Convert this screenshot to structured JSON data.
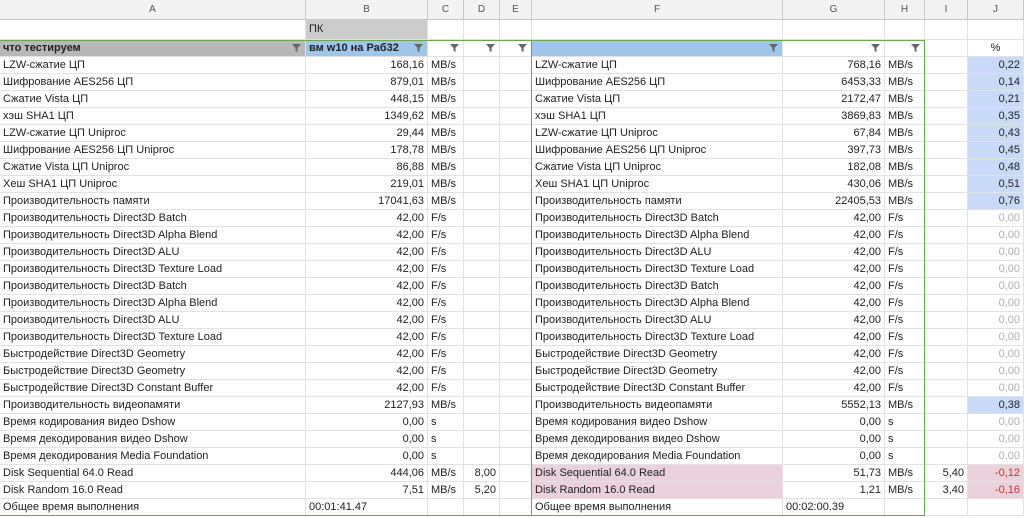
{
  "columns": [
    "A",
    "B",
    "C",
    "D",
    "E",
    "F",
    "G",
    "H",
    "I",
    "J"
  ],
  "pk_label": "ПК",
  "header": {
    "a": "что тестируем",
    "b": "вм w10 на Раб32",
    "j": "%"
  },
  "rows": [
    {
      "a": "LZW-сжатие ЦП",
      "b": "168,16",
      "c": "MB/s",
      "d": "",
      "f": "LZW-сжатие ЦП",
      "g": "768,16",
      "h": "MB/s",
      "i": "",
      "j": "0,22",
      "jc": "blue"
    },
    {
      "a": "Шифрование AES256 ЦП",
      "b": "879,01",
      "c": "MB/s",
      "d": "",
      "f": "Шифрование AES256 ЦП",
      "g": "6453,33",
      "h": "MB/s",
      "i": "",
      "j": "0,14",
      "jc": "blue"
    },
    {
      "a": "Сжатие Vista ЦП",
      "b": "448,15",
      "c": "MB/s",
      "d": "",
      "f": "Сжатие Vista ЦП",
      "g": "2172,47",
      "h": "MB/s",
      "i": "",
      "j": "0,21",
      "jc": "blue"
    },
    {
      "a": "хэш SHA1 ЦП",
      "b": "1349,62",
      "c": "MB/s",
      "d": "",
      "f": "хэш SHA1 ЦП",
      "g": "3869,83",
      "h": "MB/s",
      "i": "",
      "j": "0,35",
      "jc": "blue"
    },
    {
      "a": "LZW-сжатие ЦП Uniproc",
      "b": "29,44",
      "c": "MB/s",
      "d": "",
      "f": "LZW-сжатие ЦП Uniproc",
      "g": "67,84",
      "h": "MB/s",
      "i": "",
      "j": "0,43",
      "jc": "blue"
    },
    {
      "a": "Шифрование AES256 ЦП Uniproc",
      "b": "178,78",
      "c": "MB/s",
      "d": "",
      "f": "Шифрование AES256 ЦП Uniproc",
      "g": "397,73",
      "h": "MB/s",
      "i": "",
      "j": "0,45",
      "jc": "blue"
    },
    {
      "a": "Сжатие Vista ЦП Uniproc",
      "b": "86,88",
      "c": "MB/s",
      "d": "",
      "f": "Сжатие Vista ЦП Uniproc",
      "g": "182,08",
      "h": "MB/s",
      "i": "",
      "j": "0,48",
      "jc": "blue"
    },
    {
      "a": "Хеш SHA1 ЦП Uniproc",
      "b": "219,01",
      "c": "MB/s",
      "d": "",
      "f": "Хеш SHA1 ЦП Uniproc",
      "g": "430,06",
      "h": "MB/s",
      "i": "",
      "j": "0,51",
      "jc": "blue"
    },
    {
      "a": "Производительность памяти",
      "b": "17041,63",
      "c": "MB/s",
      "d": "",
      "f": "Производительность памяти",
      "g": "22405,53",
      "h": "MB/s",
      "i": "",
      "j": "0,76",
      "jc": "blue"
    },
    {
      "a": "Производительность Direct3D Batch",
      "b": "42,00",
      "c": "F/s",
      "d": "",
      "f": "Производительность Direct3D Batch",
      "g": "42,00",
      "h": "F/s",
      "i": "",
      "j": "0,00",
      "jc": "grey"
    },
    {
      "a": "Производительность Direct3D Alpha Blend",
      "b": "42,00",
      "c": "F/s",
      "d": "",
      "f": "Производительность Direct3D Alpha Blend",
      "g": "42,00",
      "h": "F/s",
      "i": "",
      "j": "0,00",
      "jc": "grey"
    },
    {
      "a": "Производительность Direct3D ALU",
      "b": "42,00",
      "c": "F/s",
      "d": "",
      "f": "Производительность Direct3D ALU",
      "g": "42,00",
      "h": "F/s",
      "i": "",
      "j": "0,00",
      "jc": "grey"
    },
    {
      "a": "Производительность Direct3D Texture Load",
      "b": "42,00",
      "c": "F/s",
      "d": "",
      "f": "Производительность Direct3D Texture Load",
      "g": "42,00",
      "h": "F/s",
      "i": "",
      "j": "0,00",
      "jc": "grey"
    },
    {
      "a": "Производительность Direct3D Batch",
      "b": "42,00",
      "c": "F/s",
      "d": "",
      "f": "Производительность Direct3D Batch",
      "g": "42,00",
      "h": "F/s",
      "i": "",
      "j": "0,00",
      "jc": "grey"
    },
    {
      "a": "Производительность Direct3D Alpha Blend",
      "b": "42,00",
      "c": "F/s",
      "d": "",
      "f": "Производительность Direct3D Alpha Blend",
      "g": "42,00",
      "h": "F/s",
      "i": "",
      "j": "0,00",
      "jc": "grey"
    },
    {
      "a": "Производительность Direct3D ALU",
      "b": "42,00",
      "c": "F/s",
      "d": "",
      "f": "Производительность Direct3D ALU",
      "g": "42,00",
      "h": "F/s",
      "i": "",
      "j": "0,00",
      "jc": "grey"
    },
    {
      "a": "Производительность Direct3D Texture Load",
      "b": "42,00",
      "c": "F/s",
      "d": "",
      "f": "Производительность Direct3D Texture Load",
      "g": "42,00",
      "h": "F/s",
      "i": "",
      "j": "0,00",
      "jc": "grey"
    },
    {
      "a": "Быстродействие Direct3D Geometry",
      "b": "42,00",
      "c": "F/s",
      "d": "",
      "f": "Быстродействие Direct3D Geometry",
      "g": "42,00",
      "h": "F/s",
      "i": "",
      "j": "0,00",
      "jc": "grey"
    },
    {
      "a": "Быстродействие Direct3D Geometry",
      "b": "42,00",
      "c": "F/s",
      "d": "",
      "f": "Быстродействие Direct3D Geometry",
      "g": "42,00",
      "h": "F/s",
      "i": "",
      "j": "0,00",
      "jc": "grey"
    },
    {
      "a": "Быстродействие Direct3D Constant Buffer",
      "b": "42,00",
      "c": "F/s",
      "d": "",
      "f": "Быстродействие Direct3D Constant Buffer",
      "g": "42,00",
      "h": "F/s",
      "i": "",
      "j": "0,00",
      "jc": "grey"
    },
    {
      "a": "Производительность видеопамяти",
      "b": "2127,93",
      "c": "MB/s",
      "d": "",
      "f": "Производительность видеопамяти",
      "g": "5552,13",
      "h": "MB/s",
      "i": "",
      "j": "0,38",
      "jc": "blue"
    },
    {
      "a": "Время кодирования видео Dshow",
      "b": "0,00",
      "c": "s",
      "d": "",
      "f": "Время кодирования видео Dshow",
      "g": "0,00",
      "h": "s",
      "i": "",
      "j": "0,00",
      "jc": "grey"
    },
    {
      "a": "Время декодирования видео Dshow",
      "b": "0,00",
      "c": "s",
      "d": "",
      "f": "Время декодирования видео Dshow",
      "g": "0,00",
      "h": "s",
      "i": "",
      "j": "0,00",
      "jc": "grey"
    },
    {
      "a": "Время декодирования Media Foundation",
      "b": "0,00",
      "c": "s",
      "d": "",
      "f": "Время декодирования Media Foundation",
      "g": "0,00",
      "h": "s",
      "i": "",
      "j": "0,00",
      "jc": "grey"
    },
    {
      "a": "Disk Sequential 64.0 Read",
      "b": "444,06",
      "c": "MB/s",
      "d": "8,00",
      "f": "Disk Sequential 64.0 Read",
      "g": "51,73",
      "h": "MB/s",
      "i": "5,40",
      "j": "-0,12",
      "jc": "pink"
    },
    {
      "a": "Disk Random 16.0 Read",
      "b": "7,51",
      "c": "MB/s",
      "d": "5,20",
      "f": "Disk Random 16.0 Read",
      "g": "1,21",
      "h": "MB/s",
      "i": "3,40",
      "j": "-0,16",
      "jc": "pink"
    },
    {
      "a": "Общее время выполнения",
      "b": "00:01:41.47",
      "c": "",
      "d": "",
      "f": "Общее время выполнения",
      "g": "00:02:00.39",
      "h": "",
      "i": "",
      "j": "",
      "jc": "none",
      "time": true
    }
  ]
}
